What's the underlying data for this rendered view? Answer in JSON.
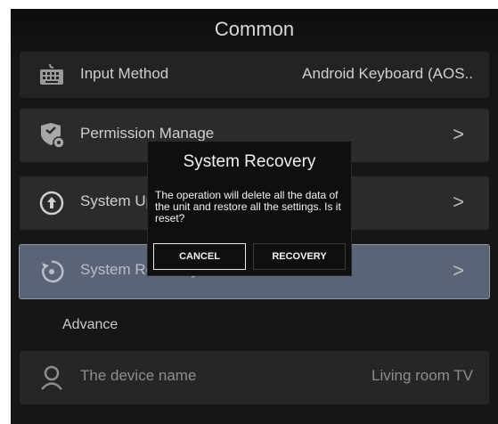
{
  "header": {
    "title": "Common"
  },
  "rows": {
    "input_method": {
      "label": "Input Method",
      "value": "Android Keyboard (AOS.."
    },
    "permission": {
      "label": "Permission Manage",
      "chevron": ">"
    },
    "system_update": {
      "label": "System Update",
      "chevron": ">"
    },
    "system_recovery": {
      "label": "System Recovery",
      "chevron": ">"
    },
    "device_name": {
      "label": "The device name",
      "value": "Living room TV"
    }
  },
  "sections": {
    "advance": "Advance"
  },
  "dialog": {
    "title": "System Recovery",
    "message": "The operation will delete all the data of the unit and restore all the settings. Is it reset?",
    "cancel_label": "CANCEL",
    "recovery_label": "RECOVERY"
  },
  "colors": {
    "background": "#161616",
    "row": "#2b2b2b",
    "selected_row": "#5a6476",
    "dialog": "#0f0f0f"
  },
  "icons": [
    "keyboard-icon",
    "shield-gear-icon",
    "upload-arrow-icon",
    "restore-icon",
    "person-icon"
  ]
}
